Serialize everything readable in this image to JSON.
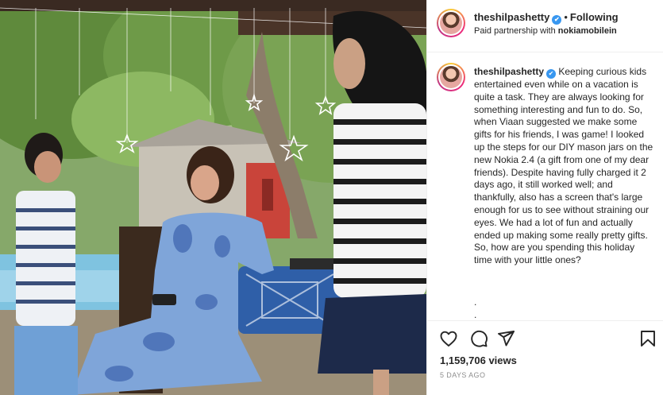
{
  "post": {
    "username": "theshilpashetty",
    "verified_mark": "✔",
    "separator": "•",
    "follow_status": "Following",
    "partnership_prefix": "Paid partnership with ",
    "partner": "nokiamobilein",
    "caption_text": "Keeping curious kids entertained even while on a vacation is quite a task. They are always looking for something interesting and fun to do. So, when Viaan suggested we make some gifts for his friends, I was game! I looked up the steps for our DIY mason jars on the new Nokia 2.4 (a gift from one of my dear friends). Despite having fully charged it 2 days ago, it still worked well; and thankfully, also has a screen that's large enough for us to see without straining our eyes. We had a lot of fun and actually ended up making some really pretty gifts. So, how are you spending this holiday time with your little ones?",
    "caption_dot_1": ".",
    "caption_dot_2": ".",
    "views": "1,159,706 views",
    "time_ago": "5 DAYS AGO"
  },
  "icons": {
    "like": "heart-icon",
    "comment": "comment-icon",
    "share": "send-icon",
    "save": "bookmark-icon",
    "verified": "verified-badge-icon"
  },
  "colors": {
    "verified_blue": "#3897f0",
    "text_primary": "#262626",
    "text_secondary": "#8e8e8e",
    "divider": "#efefef"
  }
}
